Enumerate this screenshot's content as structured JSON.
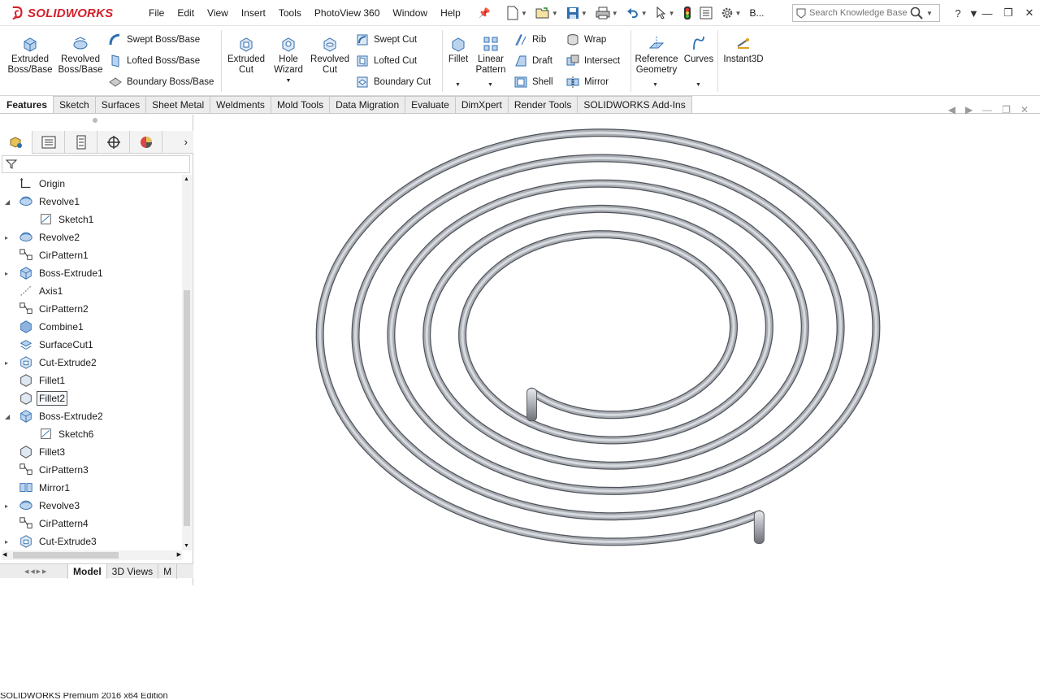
{
  "app": {
    "logo_text": "SOLIDWORKS"
  },
  "menu": [
    "File",
    "Edit",
    "View",
    "Insert",
    "Tools",
    "PhotoView 360",
    "Window",
    "Help"
  ],
  "quick_access": {
    "overflow_label": "B..."
  },
  "search": {
    "placeholder": "Search Knowledge Base"
  },
  "ribbon": {
    "extruded_boss": "Extruded\nBoss/Base",
    "revolved_boss": "Revolved\nBoss/Base",
    "swept_boss": "Swept Boss/Base",
    "lofted_boss": "Lofted Boss/Base",
    "boundary_boss": "Boundary Boss/Base",
    "extruded_cut": "Extruded\nCut",
    "hole_wizard": "Hole\nWizard",
    "revolved_cut": "Revolved\nCut",
    "swept_cut": "Swept Cut",
    "lofted_cut": "Lofted Cut",
    "boundary_cut": "Boundary Cut",
    "fillet": "Fillet",
    "linear_pattern": "Linear\nPattern",
    "rib": "Rib",
    "draft": "Draft",
    "shell": "Shell",
    "wrap": "Wrap",
    "intersect": "Intersect",
    "mirror": "Mirror",
    "reference_geometry": "Reference\nGeometry",
    "curves": "Curves",
    "instant3d": "Instant3D"
  },
  "tabs": [
    "Features",
    "Sketch",
    "Surfaces",
    "Sheet Metal",
    "Weldments",
    "Mold Tools",
    "Data Migration",
    "Evaluate",
    "DimXpert",
    "Render Tools",
    "SOLIDWORKS Add-Ins"
  ],
  "tree": [
    {
      "label": "Origin",
      "icon": "origin",
      "indent": 0,
      "expander": ""
    },
    {
      "label": "Revolve1",
      "icon": "revolve",
      "indent": 0,
      "expander": "open"
    },
    {
      "label": "Sketch1",
      "icon": "sketch",
      "indent": 1,
      "expander": ""
    },
    {
      "label": "Revolve2",
      "icon": "revolve",
      "indent": 0,
      "expander": "closed"
    },
    {
      "label": "CirPattern1",
      "icon": "pattern",
      "indent": 0,
      "expander": ""
    },
    {
      "label": "Boss-Extrude1",
      "icon": "extrude",
      "indent": 0,
      "expander": "closed"
    },
    {
      "label": "Axis1",
      "icon": "axis",
      "indent": 0,
      "expander": ""
    },
    {
      "label": "CirPattern2",
      "icon": "pattern",
      "indent": 0,
      "expander": ""
    },
    {
      "label": "Combine1",
      "icon": "combine",
      "indent": 0,
      "expander": ""
    },
    {
      "label": "SurfaceCut1",
      "icon": "surfacecut",
      "indent": 0,
      "expander": ""
    },
    {
      "label": "Cut-Extrude2",
      "icon": "cut",
      "indent": 0,
      "expander": "closed"
    },
    {
      "label": "Fillet1",
      "icon": "fillet",
      "indent": 0,
      "expander": ""
    },
    {
      "label": "Fillet2",
      "icon": "fillet",
      "indent": 0,
      "expander": "",
      "selected": true
    },
    {
      "label": "Boss-Extrude2",
      "icon": "extrude",
      "indent": 0,
      "expander": "open"
    },
    {
      "label": "Sketch6",
      "icon": "sketch",
      "indent": 1,
      "expander": ""
    },
    {
      "label": "Fillet3",
      "icon": "fillet",
      "indent": 0,
      "expander": ""
    },
    {
      "label": "CirPattern3",
      "icon": "pattern",
      "indent": 0,
      "expander": ""
    },
    {
      "label": "Mirror1",
      "icon": "mirror",
      "indent": 0,
      "expander": ""
    },
    {
      "label": "Revolve3",
      "icon": "revolve",
      "indent": 0,
      "expander": "closed"
    },
    {
      "label": "CirPattern4",
      "icon": "pattern",
      "indent": 0,
      "expander": ""
    },
    {
      "label": "Cut-Extrude3",
      "icon": "cut",
      "indent": 0,
      "expander": "closed"
    }
  ],
  "bottom_tabs": [
    "Model",
    "3D Views",
    "M"
  ],
  "status": "SOLIDWORKS Premium 2016 x64 Edition",
  "colors": {
    "brand_red": "#d4202a",
    "icon_blue": "#2f6fb0",
    "metal": "#a9adb3"
  }
}
